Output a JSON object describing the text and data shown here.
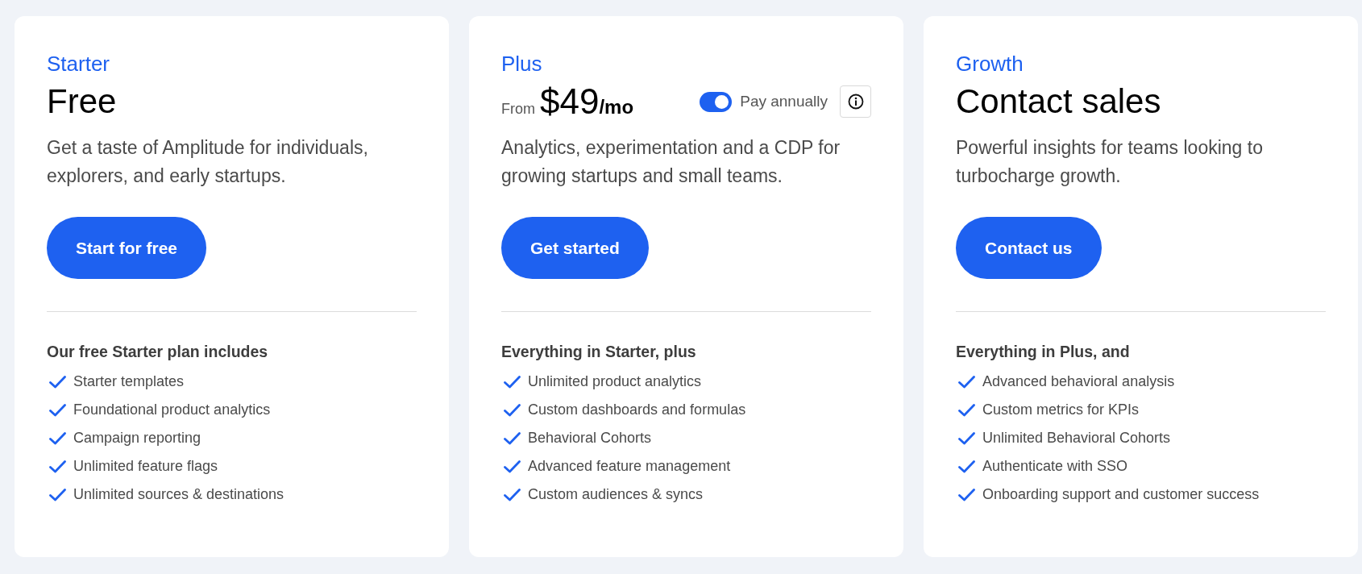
{
  "plans": [
    {
      "kind": "simple",
      "name": "Starter",
      "price": "Free",
      "description": "Get a taste of Amplitude for individuals, explorers, and early startups.",
      "button": "Start for free",
      "features_heading": "Our free Starter plan includes",
      "features": [
        "Starter templates",
        "Foundational product analytics",
        "Campaign reporting",
        "Unlimited feature flags",
        "Unlimited sources & destinations"
      ]
    },
    {
      "kind": "priced",
      "name": "Plus",
      "price_prefix": "From",
      "price": "$49",
      "price_unit": "/mo",
      "toggle": {
        "label": "Pay annually",
        "on": true
      },
      "description": "Analytics, experimentation and a CDP for growing startups and small teams.",
      "button": "Get started",
      "features_heading": "Everything in Starter, plus",
      "features": [
        "Unlimited product analytics",
        "Custom dashboards and formulas",
        "Behavioral Cohorts",
        "Advanced feature management",
        "Custom audiences & syncs"
      ]
    },
    {
      "kind": "simple",
      "name": "Growth",
      "price": "Contact sales",
      "description": "Powerful insights for teams looking to turbocharge growth.",
      "button": "Contact us",
      "features_heading": "Everything in Plus, and",
      "features": [
        "Advanced behavioral analysis",
        "Custom metrics for KPIs",
        "Unlimited Behavioral Cohorts",
        "Authenticate with SSO",
        "Onboarding support and customer success"
      ]
    }
  ]
}
